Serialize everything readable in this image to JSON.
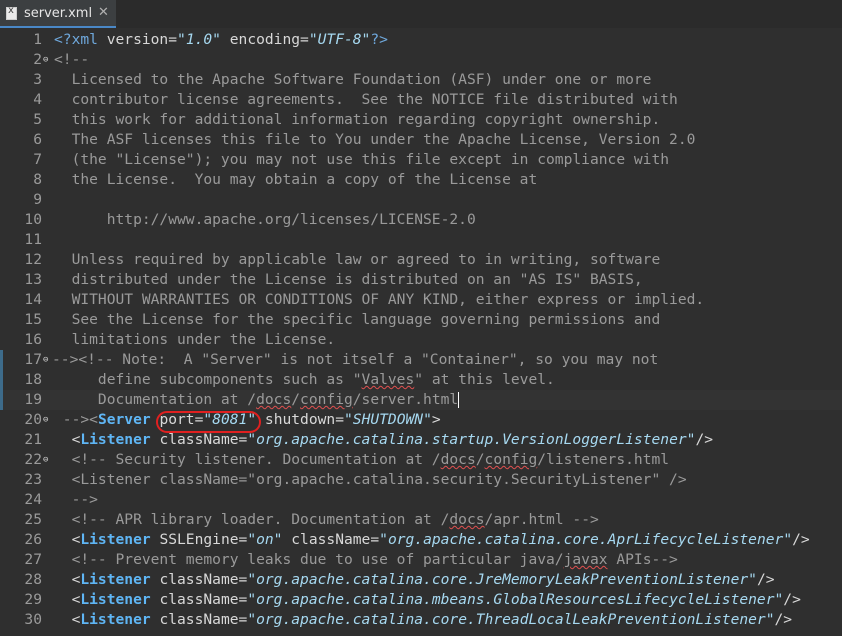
{
  "tab": {
    "filename": "server.xml",
    "close": "✕",
    "icon": "xml-file-icon"
  },
  "colors": {
    "comment": "#9a9a9a",
    "tag": "#5fb6f5",
    "string": "#a6d8f0",
    "background": "#2f2f2f"
  },
  "lines": [
    {
      "n": "1",
      "fold": ""
    },
    {
      "n": "2",
      "fold": "⊖"
    },
    {
      "n": "3"
    },
    {
      "n": "4"
    },
    {
      "n": "5"
    },
    {
      "n": "6"
    },
    {
      "n": "7"
    },
    {
      "n": "8"
    },
    {
      "n": "9"
    },
    {
      "n": "10"
    },
    {
      "n": "11"
    },
    {
      "n": "12"
    },
    {
      "n": "13"
    },
    {
      "n": "14"
    },
    {
      "n": "15"
    },
    {
      "n": "16"
    },
    {
      "n": "17",
      "fold": "⊖"
    },
    {
      "n": "18"
    },
    {
      "n": "19"
    },
    {
      "n": "20",
      "fold": "⊖"
    },
    {
      "n": "21"
    },
    {
      "n": "22",
      "fold": "⊖"
    },
    {
      "n": "23"
    },
    {
      "n": "24"
    },
    {
      "n": "25"
    },
    {
      "n": "26"
    },
    {
      "n": "27"
    },
    {
      "n": "28"
    },
    {
      "n": "29"
    },
    {
      "n": "30"
    }
  ],
  "code": {
    "l1": {
      "a": "<?xml ",
      "b": "version",
      "c": "=",
      "d": "\"1.0\"",
      "e": " encoding",
      "f": "=",
      "g": "\"UTF-8\"",
      "h": "?>"
    },
    "l2": "<!--",
    "l3": "  Licensed to the Apache Software Foundation (ASF) under one or more",
    "l4": "  contributor license agreements.  See the NOTICE file distributed with",
    "l5": "  this work for additional information regarding copyright ownership.",
    "l6": "  The ASF licenses this file to You under the Apache License, Version 2.0",
    "l7": "  (the \"License\"); you may not use this file except in compliance with",
    "l8": "  the License.  You may obtain a copy of the License at",
    "l9": "",
    "l10": "      http://www.apache.org/licenses/LICENSE-2.0",
    "l11": "",
    "l12": "  Unless required by applicable law or agreed to in writing, software",
    "l13": "  distributed under the License is distributed on an \"AS IS\" BASIS,",
    "l14": "  WITHOUT WARRANTIES OR CONDITIONS OF ANY KIND, either express or implied.",
    "l15": "  See the License for the specific language governing permissions and",
    "l16": "  limitations under the License.",
    "l17": {
      "a": "--><!-- Note:  A \"Server\" is not itself a \"Container\", so you may not"
    },
    "l18": {
      "a": "     define subcomponents such as \"",
      "b": "Valves",
      "c": "\" at this level."
    },
    "l19": {
      "a": "     Documentation at /",
      "b": "docs",
      "c": "/",
      "d": "config",
      "e": "/server.html"
    },
    "l20": {
      "a": " --><",
      "b": "Server",
      "c": " ",
      "d": "port",
      "e": "=",
      "f": "\"8081\"",
      "g": " shutdown",
      "h": "=",
      "i": "\"SHUTDOWN\"",
      "j": ">"
    },
    "l21": {
      "a": "  <",
      "b": "Listener",
      "c": " className",
      "d": "=",
      "e": "\"org.apache.catalina.startup.VersionLoggerListener\"",
      "f": "/>"
    },
    "l22": {
      "a": "  <!-- Security listener. Documentation at /",
      "b": "docs",
      "c": "/",
      "d": "config",
      "e": "/listeners.html"
    },
    "l23": "  <Listener className=\"org.apache.catalina.security.SecurityListener\" />",
    "l24": "  -->",
    "l25": {
      "a": "  <!-- APR library loader. Documentation at /",
      "b": "docs",
      "c": "/apr.html -->"
    },
    "l26": {
      "a": "  <",
      "b": "Listener",
      "c": " SSLEngine",
      "d": "=",
      "e": "\"on\"",
      "f": " className",
      "g": "=",
      "h": "\"org.apache.catalina.core.AprLifecycleListener\"",
      "i": "/>"
    },
    "l27": {
      "a": "  <!-- Prevent memory leaks due to use of particular java/",
      "b": "javax",
      "c": " APIs-->"
    },
    "l28": {
      "a": "  <",
      "b": "Listener",
      "c": " className",
      "d": "=",
      "e": "\"org.apache.catalina.core.JreMemoryLeakPreventionListener\"",
      "f": "/>"
    },
    "l29": {
      "a": "  <",
      "b": "Listener",
      "c": " className",
      "d": "=",
      "e": "\"org.apache.catalina.mbeans.GlobalResourcesLifecycleListener\"",
      "f": "/>"
    },
    "l30": {
      "a": "  <",
      "b": "Listener",
      "c": " className",
      "d": "=",
      "e": "\"org.apache.catalina.core.ThreadLocalLeakPreventionListener\"",
      "f": "/>"
    }
  }
}
